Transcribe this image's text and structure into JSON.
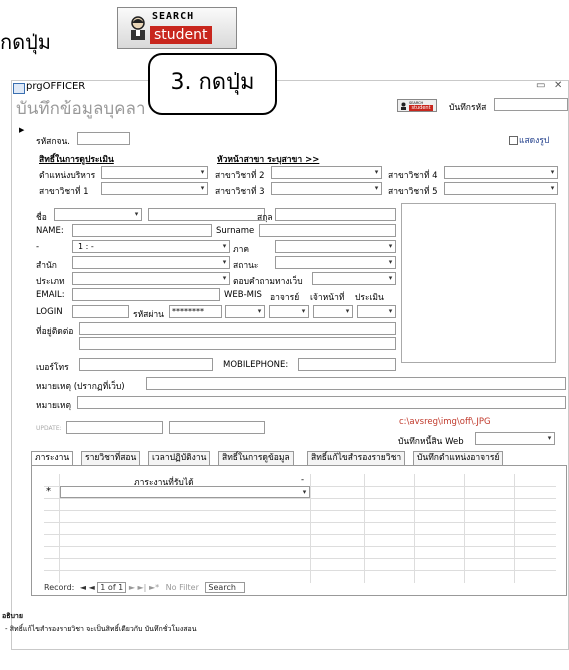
{
  "caption": {
    "text": "กดปุ่ม"
  },
  "search_button": {
    "line1": "SEARCH",
    "line2": "student"
  },
  "window": {
    "title": "prgOFFICER",
    "form_title": "บันทึกข้อมูลบุคลา",
    "min_icon": "▭",
    "close_icon": "✕",
    "record_search_label": "บันทึกรหัส"
  },
  "callout": {
    "text": "3. กดปุ่ม"
  },
  "header": {
    "staff_id_label": "รหัสกจน.",
    "show_photo_label": "แสดงรูป",
    "rights_heading": "สิทธิ์ในการดูประเมิน",
    "branch_heading": "หัวหน้าสาขา ระบุสาขา >>",
    "position_label": "ตำแหน่งบริหาร",
    "branch1_label": "สาขาวิชาที่ 1",
    "branch2_label": "สาขาวิชาที่ 2",
    "branch3_label": "สาขาวิชาที่ 3",
    "branch4_label": "สาขาวิชาที่ 4",
    "branch5_label": "สาขาวิชาที่ 5"
  },
  "person": {
    "name_label": "ชื่อ",
    "lastname_label": "สกุล",
    "name_en_label": "NAME:",
    "surname_label": "Surname",
    "dash_label": "-",
    "dash_value": "1 : -",
    "dept_label": "ภาค",
    "office_label": "สำนัก",
    "status_label": "สถานะ",
    "type_label": "ประเภท",
    "web_answer_label": "ตอบคำถามทางเว็บ",
    "email_label": "EMAIL:",
    "webmis_label": "WEB-MIS",
    "teacher_label": "อาจารย์",
    "officer_label": "เจ้าหน้าที่",
    "eval_label": "ประเมิน",
    "login_label": "LOGIN",
    "password_label": "รหัสผ่าน",
    "password_value": "********",
    "address_label": "ที่อยู่ติดต่อ",
    "phone_label": "เบอร์โทร",
    "mobile_label": "MOBILEPHONE:",
    "remark_web_label": "หมายเหตุ (ปรากฏที่เว็บ)",
    "remark_label": "หมายเหตุ",
    "update_label": "UPDATE:",
    "photo_path": "c:\\avsreg\\img\\off\\.JPG",
    "web_last_label": "บันทึกหนี้สิน Web"
  },
  "tabs": [
    {
      "label": "ภาระงาน"
    },
    {
      "label": "รายวิชาที่สอน"
    },
    {
      "label": "เวลาปฏิบัติงาน"
    },
    {
      "label": "สิทธิ์ในการดูข้อมูล"
    },
    {
      "label": "สิทธิ์แก้ไขสำรองรายวิชา"
    },
    {
      "label": "บันทึกตำแหน่งอาจารย์"
    }
  ],
  "subform": {
    "column_header": "ภาระงานที่รับได้",
    "new_row_marker": "*",
    "nav": {
      "record_label": "Record:",
      "first": "◄",
      "prev": "◄",
      "position": "1 of 1",
      "next": "►",
      "last": "►|",
      "new": "►*",
      "filter": "No Filter",
      "search": "Search"
    }
  },
  "notes": {
    "heading": "อธิบาย",
    "line1": "- สิทธิ์แก้ไขสำรองรายวิชา จะเป็นสิทธิ์เดียวกับ บันทึกชั่วโมงสอน"
  },
  "colors": {
    "accent_red": "#c8261d",
    "path_red": "#c0392b",
    "link_blue": "#1f3d8a"
  }
}
